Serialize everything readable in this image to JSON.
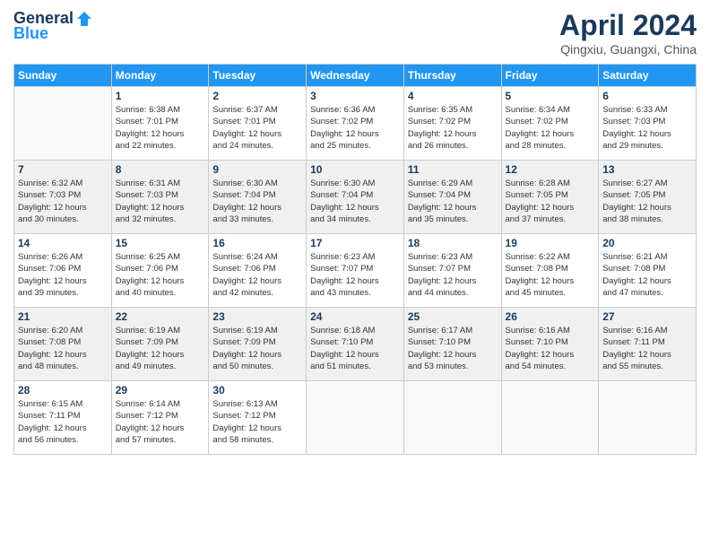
{
  "header": {
    "logo_general": "General",
    "logo_blue": "Blue",
    "month_title": "April 2024",
    "location": "Qingxiu, Guangxi, China"
  },
  "days_of_week": [
    "Sunday",
    "Monday",
    "Tuesday",
    "Wednesday",
    "Thursday",
    "Friday",
    "Saturday"
  ],
  "weeks": [
    [
      {
        "day": "",
        "info": ""
      },
      {
        "day": "1",
        "info": "Sunrise: 6:38 AM\nSunset: 7:01 PM\nDaylight: 12 hours\nand 22 minutes."
      },
      {
        "day": "2",
        "info": "Sunrise: 6:37 AM\nSunset: 7:01 PM\nDaylight: 12 hours\nand 24 minutes."
      },
      {
        "day": "3",
        "info": "Sunrise: 6:36 AM\nSunset: 7:02 PM\nDaylight: 12 hours\nand 25 minutes."
      },
      {
        "day": "4",
        "info": "Sunrise: 6:35 AM\nSunset: 7:02 PM\nDaylight: 12 hours\nand 26 minutes."
      },
      {
        "day": "5",
        "info": "Sunrise: 6:34 AM\nSunset: 7:02 PM\nDaylight: 12 hours\nand 28 minutes."
      },
      {
        "day": "6",
        "info": "Sunrise: 6:33 AM\nSunset: 7:03 PM\nDaylight: 12 hours\nand 29 minutes."
      }
    ],
    [
      {
        "day": "7",
        "info": "Sunrise: 6:32 AM\nSunset: 7:03 PM\nDaylight: 12 hours\nand 30 minutes."
      },
      {
        "day": "8",
        "info": "Sunrise: 6:31 AM\nSunset: 7:03 PM\nDaylight: 12 hours\nand 32 minutes."
      },
      {
        "day": "9",
        "info": "Sunrise: 6:30 AM\nSunset: 7:04 PM\nDaylight: 12 hours\nand 33 minutes."
      },
      {
        "day": "10",
        "info": "Sunrise: 6:30 AM\nSunset: 7:04 PM\nDaylight: 12 hours\nand 34 minutes."
      },
      {
        "day": "11",
        "info": "Sunrise: 6:29 AM\nSunset: 7:04 PM\nDaylight: 12 hours\nand 35 minutes."
      },
      {
        "day": "12",
        "info": "Sunrise: 6:28 AM\nSunset: 7:05 PM\nDaylight: 12 hours\nand 37 minutes."
      },
      {
        "day": "13",
        "info": "Sunrise: 6:27 AM\nSunset: 7:05 PM\nDaylight: 12 hours\nand 38 minutes."
      }
    ],
    [
      {
        "day": "14",
        "info": "Sunrise: 6:26 AM\nSunset: 7:06 PM\nDaylight: 12 hours\nand 39 minutes."
      },
      {
        "day": "15",
        "info": "Sunrise: 6:25 AM\nSunset: 7:06 PM\nDaylight: 12 hours\nand 40 minutes."
      },
      {
        "day": "16",
        "info": "Sunrise: 6:24 AM\nSunset: 7:06 PM\nDaylight: 12 hours\nand 42 minutes."
      },
      {
        "day": "17",
        "info": "Sunrise: 6:23 AM\nSunset: 7:07 PM\nDaylight: 12 hours\nand 43 minutes."
      },
      {
        "day": "18",
        "info": "Sunrise: 6:23 AM\nSunset: 7:07 PM\nDaylight: 12 hours\nand 44 minutes."
      },
      {
        "day": "19",
        "info": "Sunrise: 6:22 AM\nSunset: 7:08 PM\nDaylight: 12 hours\nand 45 minutes."
      },
      {
        "day": "20",
        "info": "Sunrise: 6:21 AM\nSunset: 7:08 PM\nDaylight: 12 hours\nand 47 minutes."
      }
    ],
    [
      {
        "day": "21",
        "info": "Sunrise: 6:20 AM\nSunset: 7:08 PM\nDaylight: 12 hours\nand 48 minutes."
      },
      {
        "day": "22",
        "info": "Sunrise: 6:19 AM\nSunset: 7:09 PM\nDaylight: 12 hours\nand 49 minutes."
      },
      {
        "day": "23",
        "info": "Sunrise: 6:19 AM\nSunset: 7:09 PM\nDaylight: 12 hours\nand 50 minutes."
      },
      {
        "day": "24",
        "info": "Sunrise: 6:18 AM\nSunset: 7:10 PM\nDaylight: 12 hours\nand 51 minutes."
      },
      {
        "day": "25",
        "info": "Sunrise: 6:17 AM\nSunset: 7:10 PM\nDaylight: 12 hours\nand 53 minutes."
      },
      {
        "day": "26",
        "info": "Sunrise: 6:16 AM\nSunset: 7:10 PM\nDaylight: 12 hours\nand 54 minutes."
      },
      {
        "day": "27",
        "info": "Sunrise: 6:16 AM\nSunset: 7:11 PM\nDaylight: 12 hours\nand 55 minutes."
      }
    ],
    [
      {
        "day": "28",
        "info": "Sunrise: 6:15 AM\nSunset: 7:11 PM\nDaylight: 12 hours\nand 56 minutes."
      },
      {
        "day": "29",
        "info": "Sunrise: 6:14 AM\nSunset: 7:12 PM\nDaylight: 12 hours\nand 57 minutes."
      },
      {
        "day": "30",
        "info": "Sunrise: 6:13 AM\nSunset: 7:12 PM\nDaylight: 12 hours\nand 58 minutes."
      },
      {
        "day": "",
        "info": ""
      },
      {
        "day": "",
        "info": ""
      },
      {
        "day": "",
        "info": ""
      },
      {
        "day": "",
        "info": ""
      }
    ]
  ]
}
